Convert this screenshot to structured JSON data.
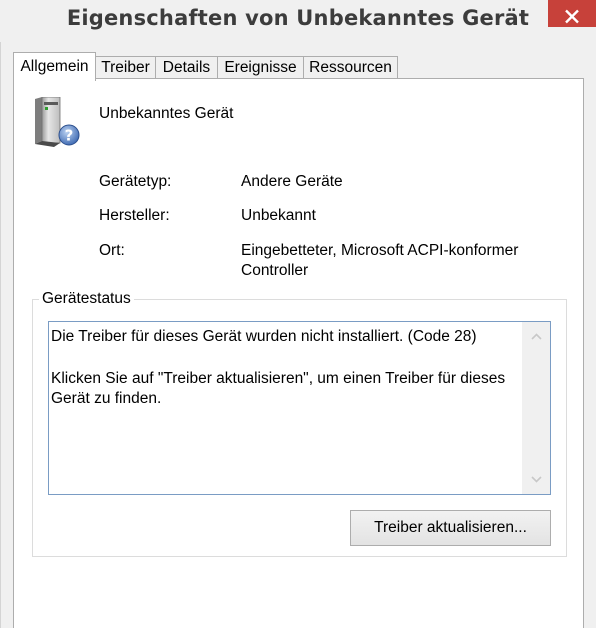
{
  "window": {
    "title": "Eigenschaften von Unbekanntes Gerät"
  },
  "tabs": [
    {
      "label": "Allgemein",
      "active": true
    },
    {
      "label": "Treiber",
      "active": false
    },
    {
      "label": "Details",
      "active": false
    },
    {
      "label": "Ereignisse",
      "active": false
    },
    {
      "label": "Ressourcen",
      "active": false
    }
  ],
  "device": {
    "name": "Unbekanntes Gerät",
    "icon": "unknown-device-icon"
  },
  "properties": {
    "type_label": "Gerätetyp:",
    "type_value": "Andere Geräte",
    "manufacturer_label": "Hersteller:",
    "manufacturer_value": "Unbekannt",
    "location_label": "Ort:",
    "location_value_line1": "Eingebetteter, Microsoft ACPI-konformer",
    "location_value_line2": "Controller"
  },
  "status": {
    "group_label": "Gerätestatus",
    "message_line1": "Die Treiber für dieses Gerät wurden nicht installiert. (Code 28)",
    "message_line2": "Klicken Sie auf \"Treiber aktualisieren\", um einen Treiber für dieses Gerät zu finden."
  },
  "buttons": {
    "update_driver": "Treiber aktualisieren..."
  },
  "colors": {
    "close_button": "#c7413a",
    "textbox_border": "#7a9cc4",
    "title_text": "#3c3c3c"
  }
}
